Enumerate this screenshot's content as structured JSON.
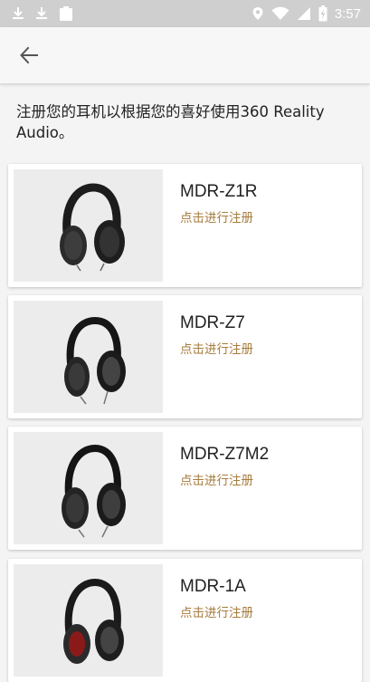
{
  "status_bar": {
    "time": "3:57",
    "left_icons": [
      "download-icon",
      "download-icon",
      "clipboard-icon"
    ],
    "right_icons": [
      "location-icon",
      "wifi-icon",
      "signal-icon",
      "battery-charging-icon"
    ]
  },
  "app_bar": {
    "back_icon": "arrow-back-icon"
  },
  "intro_text": "注册您的耳机以根据您的喜好使用360 Reality Audio。",
  "headphones": [
    {
      "model": "MDR-Z1R",
      "cta": "点击进行注册"
    },
    {
      "model": "MDR-Z7",
      "cta": "点击进行注册"
    },
    {
      "model": "MDR-Z7M2",
      "cta": "点击进行注册"
    },
    {
      "model": "MDR-1A",
      "cta": "点击进行注册"
    }
  ],
  "colors": {
    "accent_link": "#a67c3c",
    "status_bar": "#cfcfcf",
    "text": "#222222"
  }
}
